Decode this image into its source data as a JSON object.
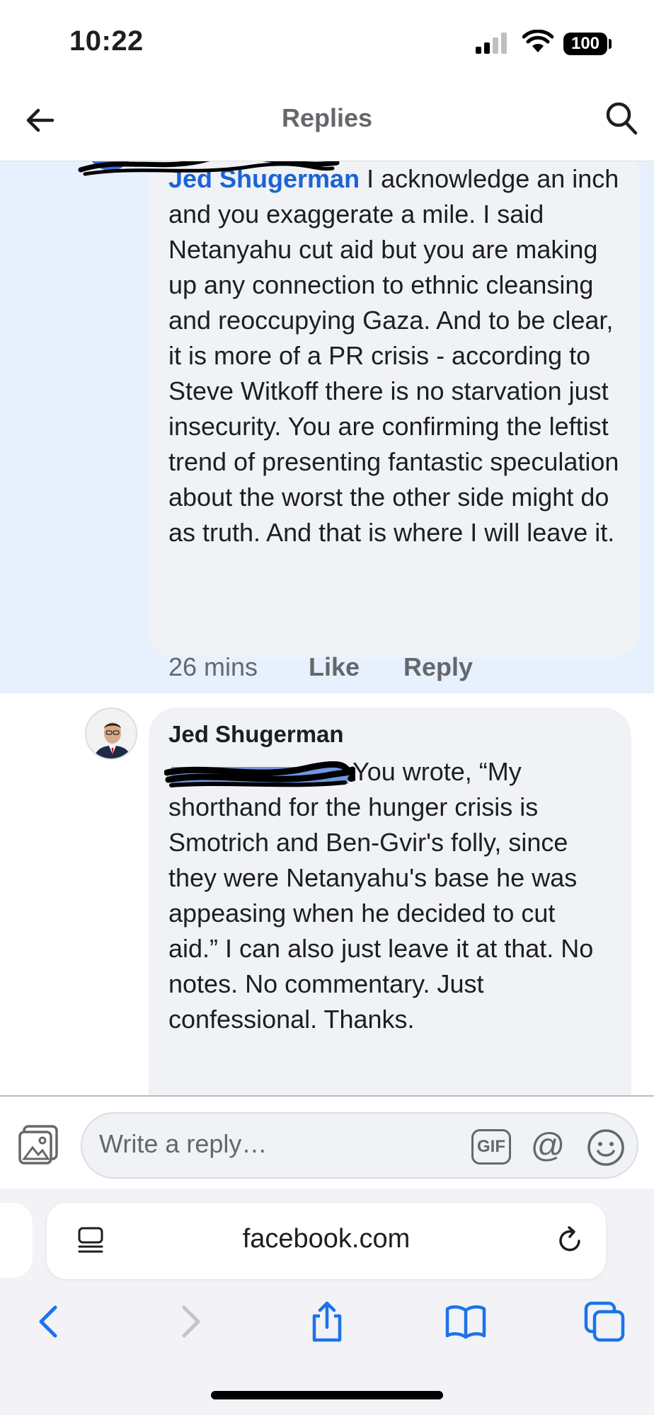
{
  "status_bar": {
    "time": "10:22",
    "battery": "100"
  },
  "header": {
    "title": "Replies"
  },
  "comments": [
    {
      "mention": "Jed Shugerman",
      "text": " I acknowledge an inch and you exaggerate a mile. I said Netanyahu cut aid but you are making up any connection to ethnic cleansing and reoccupying Gaza. And to be clear, it is more of a PR crisis -  according to Steve Witkoff there is no starvation just insecurity. You are confirming the leftist trend of presenting fantastic speculation about the worst the other side might do as truth. And that is where I will leave it.",
      "time": "26 mins",
      "like_label": "Like",
      "reply_label": "Reply"
    },
    {
      "author": "Jed Shugerman",
      "text": "You wrote, “My shorthand for the hunger crisis is Smotrich and Ben-Gvir's folly, since they were Netanyahu's base he was appeasing when he decided to cut aid.” I can also just leave it at that. No notes. No commentary. Just confessional. Thanks."
    }
  ],
  "reply_bar": {
    "placeholder": "Write a reply…",
    "gif_label": "GIF",
    "mention_symbol": "@"
  },
  "browser": {
    "address": "facebook.com"
  },
  "colors": {
    "highlight": "#e7f0fd",
    "mention": "#1b63d6",
    "bubble": "#f0f2f5",
    "secondary_text": "#65676b",
    "ios_blue": "#1b73e8"
  }
}
